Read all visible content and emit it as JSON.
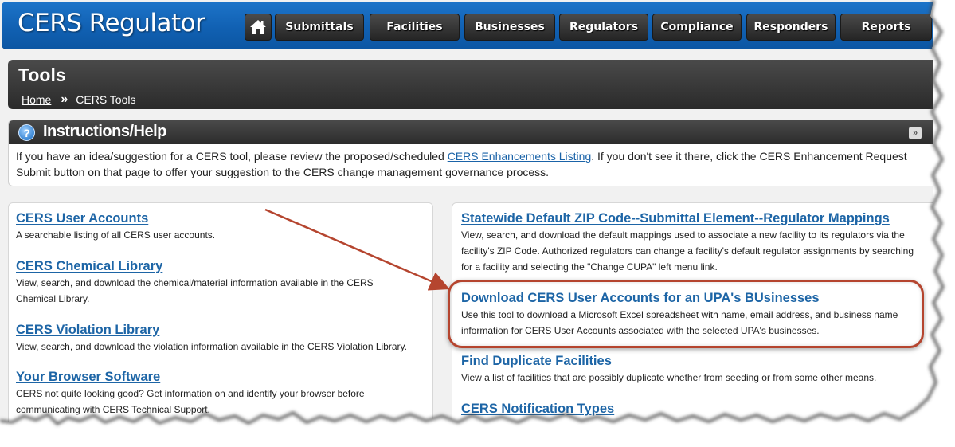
{
  "header": {
    "app_title": "CERS Regulator",
    "home_icon": "home-icon",
    "nav": [
      {
        "label": "Submittals"
      },
      {
        "label": "Facilities"
      },
      {
        "label": "Businesses"
      },
      {
        "label": "Regulators"
      },
      {
        "label": "Compliance"
      },
      {
        "label": "Responders"
      },
      {
        "label": "Reports"
      }
    ]
  },
  "page": {
    "title": "Tools",
    "breadcrumb": {
      "home": "Home",
      "separator": "»",
      "current": "CERS Tools"
    }
  },
  "instructions": {
    "icon": "help-icon",
    "title": "Instructions/Help",
    "collapse_icon": "chevron-double-down-icon",
    "text_before": "If you have an idea/suggestion for a CERS tool, please review the proposed/scheduled ",
    "link": "CERS Enhancements Listing",
    "text_after": ". If you don't see it there, click the CERS Enhancement Request Submit button on that page to offer your suggestion to the CERS change management governance process."
  },
  "tools_left": [
    {
      "title": "CERS User Accounts",
      "description": "A searchable listing of all CERS user accounts."
    },
    {
      "title": "CERS Chemical Library",
      "description": "View, search, and download the chemical/material information available in the CERS Chemical Library."
    },
    {
      "title": "CERS Violation Library",
      "description": "View, search, and download the violation information available in the CERS Violation Library."
    },
    {
      "title": "Your Browser Software",
      "description": "CERS not quite looking good? Get information on and identify your browser before communicating with CERS Technical Support."
    }
  ],
  "tools_right": [
    {
      "title": "Statewide Default ZIP Code--Submittal Element--Regulator Mappings",
      "description": "View, search, and download the default mappings used to associate a new facility to its regulators via the facility's ZIP Code. Authorized regulators can change a facility's default regulator assignments by searching for a facility and selecting the \"Change CUPA\" left menu link."
    },
    {
      "title": "Download CERS User Accounts for an UPA's BUsinesses",
      "description": "Use this tool to download a Microsoft Excel spreadsheet with name, email address, and business name information for CERS User Accounts associated with the selected UPA's businesses."
    },
    {
      "title": "Find Duplicate Facilities",
      "description": "View a list of facilities that are possibly duplicate whether from seeding or from some other means."
    },
    {
      "title": "CERS Notification Types",
      "description": ""
    }
  ],
  "annotation": {
    "highlight_color": "#b5452f",
    "arrow_color": "#b5452f"
  },
  "colors": {
    "header_blue": "#1161b3",
    "link_blue": "#1d65a6",
    "dark_bar": "#2c2c2c"
  }
}
